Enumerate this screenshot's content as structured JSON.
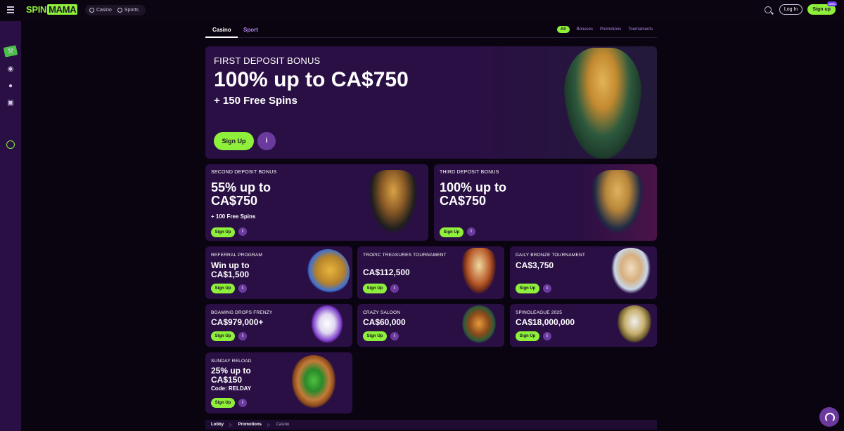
{
  "header": {
    "logo": {
      "spin": "SPIN",
      "mama": "MAMA"
    },
    "modes": [
      "Casino",
      "Sports"
    ],
    "login_label": "Log In",
    "signup_label": "Sign up",
    "signup_badge": "100%"
  },
  "tabs": {
    "casino": "Casino",
    "sport": "Sport"
  },
  "filters": [
    "All",
    "Bonuses",
    "Promotions",
    "Tournaments"
  ],
  "hero": {
    "label": "FIRST DEPOSIT BONUS",
    "head": "100% up to CA$750",
    "sub": "+ 150 Free Spins",
    "button": "Sign Up",
    "info": "i"
  },
  "cards": [
    {
      "label": "SECOND DEPOSIT BONUS",
      "head1": "55% up to",
      "head2": "CA$750",
      "sub": "+ 100 Free Spins",
      "button": "Sign Up",
      "info": "i"
    },
    {
      "label": "THIRD DEPOSIT BONUS",
      "head1": "100% up to",
      "head2": "CA$750",
      "button": "Sign Up",
      "info": "i"
    },
    {
      "label": "REFERRAL PROGRAM",
      "head1": "Win up to",
      "head2": "CA$1,500",
      "button": "Sign Up",
      "info": "i"
    },
    {
      "label": "TROPIC TREASURES TOURNAMENT",
      "head1": "CA$112,500",
      "button": "Sign Up",
      "info": "i"
    },
    {
      "label": "DAILY BRONZE TOURNAMENT",
      "head1": "CA$3,750",
      "button": "Sign Up",
      "info": "i"
    },
    {
      "label": "BGAMING DROPS FRENZY",
      "head1": "CA$979,000+",
      "button": "Sign Up",
      "info": "i"
    },
    {
      "label": "CRAZY SALOON",
      "head1": "CA$60,000",
      "button": "Sign Up",
      "info": "i"
    },
    {
      "label": "SPINOLEAGUE 2025",
      "head1": "CA$18,000,000",
      "button": "Sign Up",
      "info": "i"
    },
    {
      "label": "SUNDAY RELOAD",
      "head1": "25% up to",
      "head2": "CA$150",
      "sub": "Code: RELDAY",
      "button": "Sign Up",
      "info": "i"
    }
  ],
  "breadcrumb": [
    "Lobby",
    "Promotions",
    "Casino"
  ],
  "colors": {
    "accent": "#8ef03a",
    "card": "#2a0f44",
    "sidebar": "#2a0f44",
    "bg": "#0a0410"
  }
}
